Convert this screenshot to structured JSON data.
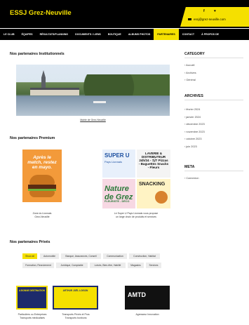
{
  "header": {
    "site_title": "ESSJ Grez-Neuville",
    "social_icons": "f  ♥",
    "email": "essj@grez-neuville.com"
  },
  "nav": [
    "LE CLUB",
    "ÉQUIPES",
    "RÉSULTATS/PLANNING",
    "DOCUMENTS / LIENS",
    "BOUTIQUE",
    "ALBUMS PHOTOS",
    "PARTENAIRES",
    "CONTACT",
    "À PROPOS DE"
  ],
  "nav_active_index": 6,
  "sections": {
    "institutional_title": "Nos partenaires Institutionnels",
    "hero_caption": "Mairie de Grez-Neuville",
    "premium_title": "Nos partenaires Premium",
    "prives_title": "Nos partenaires Privés"
  },
  "premium": [
    {
      "headline": "Après le match, restez en mayo.",
      "caption_line1": "Zone du Lionnais",
      "caption_line2": "Grez-Neuville"
    },
    {
      "super_u": "SUPER U",
      "super_u_sub": "Pays Lionnais",
      "laverie": "LAVERIE & DISTRIBUTEUR 24h/24 - 7j/7 Pizzas - Baguettes Snacks - Fleurs",
      "nature": "Nature de Grez",
      "nature_sub": "FLEURISTE - DÉCO",
      "snacking": "SNACKING",
      "caption_line1": "Le Super U Pays Lionnais vous propose",
      "caption_line2": "un large choix de produits et services"
    }
  ],
  "filters": [
    [
      "Show all",
      "Automobile",
      "Banque, Assurances, Conseil",
      "Communication",
      "Construction, Habitat"
    ],
    [
      "Formation, Recrutement",
      "Juridique, Comptable",
      "Loisirs, Bien-être, Habillé",
      "Magasins",
      "Services"
    ]
  ],
  "prives": [
    {
      "tile_text": "A BONNE DESTINATION",
      "caption_line1": "Particuliers ou Entreprises",
      "caption_line2": "Transports médicalisés"
    },
    {
      "tile_text": "ARTHUR JOËL LOISON",
      "caption_line1": "Transports Privés et Pros",
      "caption_line2": "Transports bonbons"
    },
    {
      "tile_text": "AMTD",
      "caption_line1": "Agresseur Innovation",
      "caption_line2": ""
    }
  ],
  "sidebar": {
    "category_title": "CATEGORY",
    "categories": [
      "Accueil",
      "Archives",
      "Général"
    ],
    "archives_title": "ARCHIVES",
    "archives": [
      "février 2024",
      "janvier 2024",
      "décembre 2023",
      "novembre 2023",
      "octobre 2023",
      "juin 2023"
    ],
    "meta_title": "META",
    "meta": [
      "Connexion"
    ]
  },
  "colors": {
    "accent": "#f5e000",
    "header_bg": "#000000"
  }
}
